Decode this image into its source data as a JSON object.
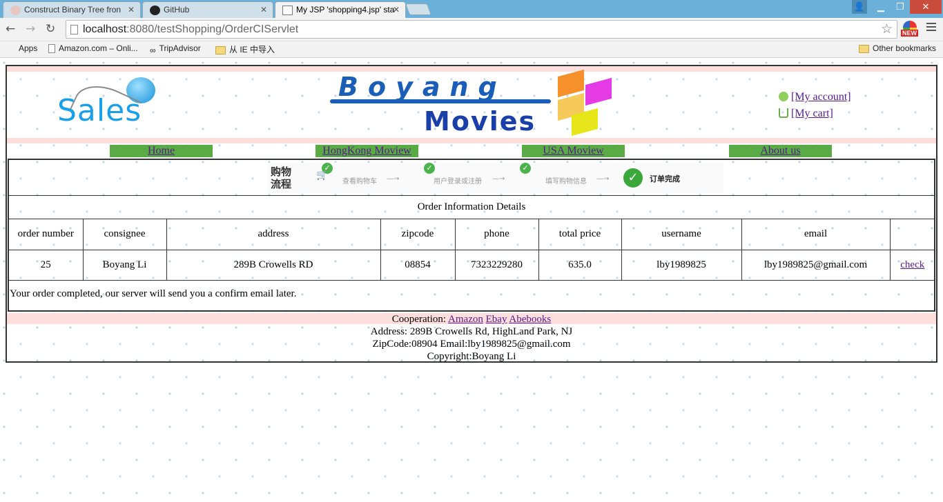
{
  "browser": {
    "tabs": [
      {
        "title": "Construct Binary Tree fron",
        "active": false
      },
      {
        "title": "GitHub",
        "active": false
      },
      {
        "title": "My JSP 'shopping4.jsp' sta",
        "active": true
      }
    ],
    "url_host": "localhost",
    "url_rest": ":8080/testShopping/OrderCIServlet",
    "ext_badge": "NEW",
    "bookmarks": [
      {
        "label": "Apps",
        "icon": "apps-grid-icon"
      },
      {
        "label": "Amazon.com – Onli...",
        "icon": "page-icon"
      },
      {
        "label": "TripAdvisor",
        "icon": "tripadvisor-icon"
      },
      {
        "label": "从 IE 中导入",
        "icon": "folder-icon"
      }
    ],
    "other_bookmarks": "Other bookmarks",
    "colors": {
      "tabbar": "#6ab0d8",
      "close": "#c94c3c"
    }
  },
  "header": {
    "logo_sales": "Sales",
    "logo_boyang": "Boyang",
    "logo_movies": "Movies",
    "my_account": "[My account]",
    "my_cart": "[My cart]"
  },
  "nav": [
    "Home",
    "HongKong Moview",
    "USA Moview",
    "About us"
  ],
  "steps": {
    "flow_label": [
      "购物",
      "流程"
    ],
    "items": [
      "查看购物车",
      "用户登录或注册",
      "填写购物信息"
    ],
    "done": "订单完成"
  },
  "order": {
    "title": "Order Information Details",
    "headers": [
      "order number",
      "consignee",
      "address",
      "zipcode",
      "phone",
      "total price",
      "username",
      "email",
      ""
    ],
    "row": [
      "25",
      "Boyang Li",
      "289B Crowells RD",
      "08854",
      "7323229280",
      "635.0",
      "lby1989825",
      "lby1989825@gmail.com"
    ],
    "action": "check",
    "message": "Your order completed, our server will send you a confirm email later."
  },
  "footer": {
    "cooperation_label": "Cooperation:",
    "partners": [
      "Amazon",
      "Ebay",
      "Abebooks"
    ],
    "address": "Address: 289B Crowells Rd, HighLand Park, NJ",
    "contact": "ZipCode:08904 Email:lby1989825@gmail.com",
    "copyright": "Copyright:Boyang Li"
  },
  "theme": {
    "nav_green": "#5aab46",
    "band_pink": "#ffdede",
    "link_purple": "#551a8b"
  }
}
